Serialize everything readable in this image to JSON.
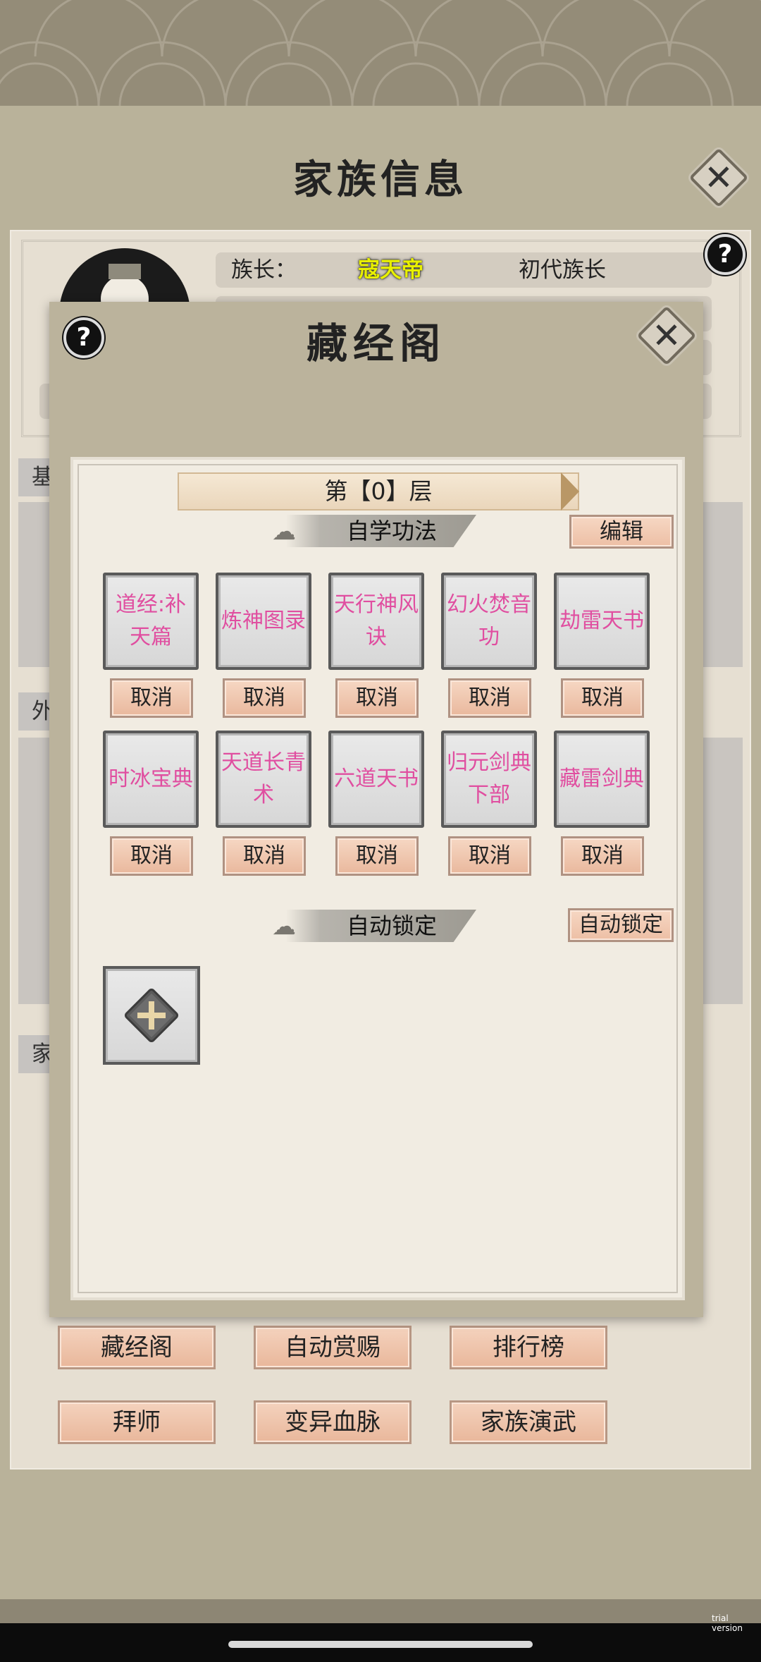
{
  "background": {
    "title": "家族信息",
    "leader_label": "族长：",
    "leader_name": "寇天帝",
    "leader_rank": "初代族长",
    "side_tabs": [
      "基",
      "外",
      "家"
    ],
    "buttons": [
      {
        "label": "藏经阁"
      },
      {
        "label": "自动赏赐"
      },
      {
        "label": "排行榜"
      },
      {
        "label": "拜师"
      },
      {
        "label": "变异血脉"
      },
      {
        "label": "家族演武"
      }
    ]
  },
  "modal": {
    "title": "藏经阁",
    "help_label": "?",
    "close_label": "✕",
    "floor_label": "第【0】层",
    "self_study": {
      "section_title": "自学功法",
      "edit_label": "编辑",
      "cancel_label": "取消",
      "skills": [
        {
          "name": "道经:补天篇"
        },
        {
          "name": "炼神图录"
        },
        {
          "name": "天行神风诀"
        },
        {
          "name": "幻火焚音功"
        },
        {
          "name": "劫雷天书"
        },
        {
          "name": "时冰宝典"
        },
        {
          "name": "天道长青术"
        },
        {
          "name": "六道天书"
        },
        {
          "name": "归元剑典下部"
        },
        {
          "name": "藏雷剑典"
        }
      ]
    },
    "auto_lock": {
      "section_title": "自动锁定",
      "button_label": "自动锁定"
    }
  },
  "system": {
    "trial_text": "trial version"
  },
  "colors": {
    "skill_text": "#e04ea0",
    "leader_name": "#e8f000",
    "button_fill": "#edbfa5",
    "modal_bg": "#bbb39c"
  }
}
